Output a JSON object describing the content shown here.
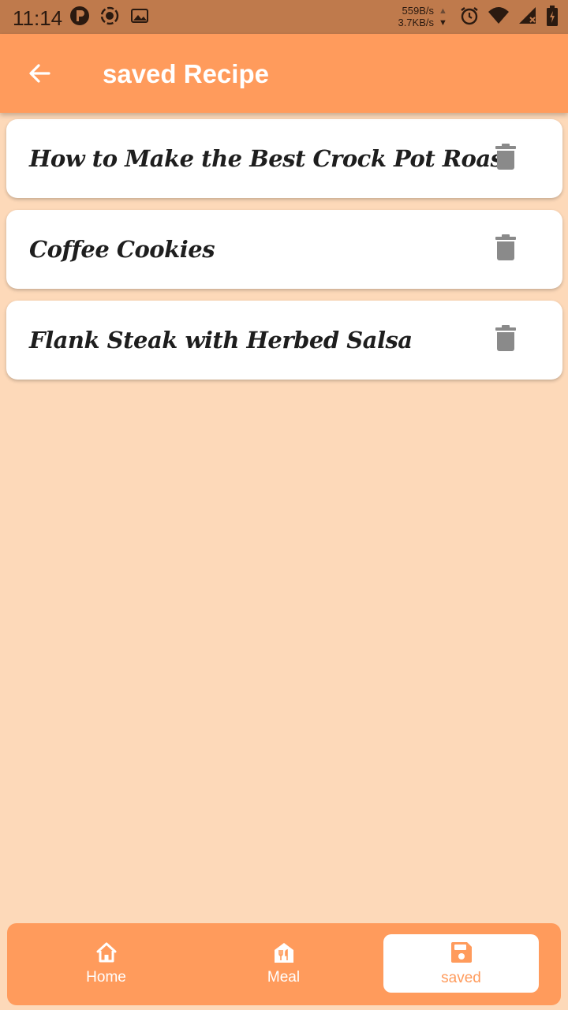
{
  "status_bar": {
    "time": "11:14",
    "upload_speed": "559B/s",
    "download_speed": "3.7KB/s",
    "icons": [
      "p-icon",
      "target-icon",
      "image-icon",
      "alarm-icon",
      "wifi-icon",
      "signal-icon",
      "battery-icon"
    ]
  },
  "app_bar": {
    "title": "saved Recipe",
    "back_icon": "arrow-left-icon"
  },
  "recipes": [
    {
      "title": "How to Make the Best Crock Pot Roast",
      "action_icon": "trash-icon"
    },
    {
      "title": "Coffee Cookies",
      "action_icon": "trash-icon"
    },
    {
      "title": "Flank Steak with Herbed Salsa",
      "action_icon": "trash-icon"
    }
  ],
  "bottom_nav": {
    "items": [
      {
        "label": "Home",
        "icon": "home-icon",
        "active": false
      },
      {
        "label": "Meal",
        "icon": "meal-icon",
        "active": false
      },
      {
        "label": "saved",
        "icon": "save-icon",
        "active": true
      }
    ]
  },
  "colors": {
    "status_bar": "#BF7A4C",
    "accent": "#FF9B5C",
    "background": "#FDD9B9",
    "card": "#FFFFFF",
    "trash_icon": "#8A8A8A"
  }
}
